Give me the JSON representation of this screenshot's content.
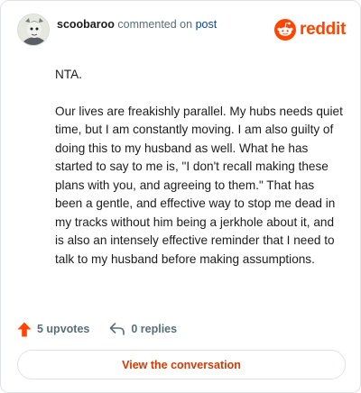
{
  "header": {
    "username": "scoobaroo",
    "verb": "commented on",
    "post_link": "post",
    "brand": "reddit"
  },
  "comment": {
    "paragraphs": [
      "NTA.",
      "Our lives are freakishly parallel. My hubs needs quiet time, but I am constantly moving. I am also guilty of doing this to my husband as well. What he has started to say to me is, \"I don't recall making these plans with you, and agreeing to them.\" That has been a gentle, and effective way to stop me dead in my tracks without him being a jerkhole about it, and is also an intensely effective reminder that I need to talk to my husband before making assumptions."
    ]
  },
  "actions": {
    "upvotes": "5 upvotes",
    "replies": "0 replies"
  },
  "cta": {
    "label": "View the conversation"
  },
  "colors": {
    "brand": "#ff4500",
    "link": "#0a449b",
    "cta": "#d93900",
    "muted": "#576f76"
  }
}
